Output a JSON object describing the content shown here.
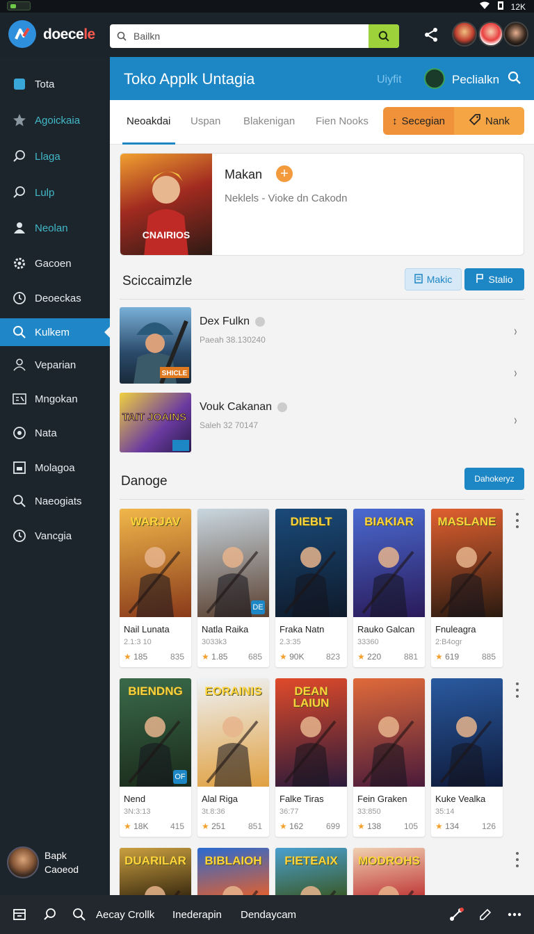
{
  "status": {
    "time": "12K"
  },
  "brand": {
    "name_main": "doece",
    "name_accent": "le"
  },
  "search": {
    "placeholder": "Bailkn"
  },
  "sidebar": {
    "items": [
      {
        "label": "Tota",
        "icon": "app-icon"
      },
      {
        "label": "Agoickaia",
        "icon": "star-icon"
      },
      {
        "label": "Llaga",
        "icon": "search-icon"
      },
      {
        "label": "Lulp",
        "icon": "search-icon"
      },
      {
        "label": "Neolan",
        "icon": "user-icon"
      },
      {
        "label": "Gacoen",
        "icon": "gear-icon"
      },
      {
        "label": "Deoeckas",
        "icon": "clock-icon"
      },
      {
        "label": "Kulkem",
        "icon": "search-icon"
      },
      {
        "label": "Veparian",
        "icon": "user-icon"
      },
      {
        "label": "Mngokan",
        "icon": "grid-icon"
      },
      {
        "label": "Nata",
        "icon": "circle-icon"
      },
      {
        "label": "Molagoa",
        "icon": "box-icon"
      },
      {
        "label": "Naeogiats",
        "icon": "search-icon"
      },
      {
        "label": "Vancgia",
        "icon": "clock-icon"
      }
    ],
    "user": {
      "line1": "Bapk",
      "line2": "Caoeod"
    }
  },
  "header": {
    "title": "Toko Applk Untagia",
    "link": "Uiyfit",
    "label": "Peclialkn"
  },
  "tabs": [
    {
      "label": "Neoakdai"
    },
    {
      "label": "Uspan"
    },
    {
      "label": "Blakenigan"
    },
    {
      "label": "Fien Nooks"
    }
  ],
  "actions": {
    "primary": "Secegian",
    "secondary": "Nank"
  },
  "featured": {
    "title": "Makan",
    "subtitle": "Neklels - Vioke dn Cakodn",
    "art_text": "CNAIRIOS"
  },
  "section1": {
    "title": "Sciccaimzle",
    "btn_light": "Makic",
    "btn_dark": "Stalio"
  },
  "list": [
    {
      "title": "Dex Fulkn",
      "sub": "Paeah 38.130240",
      "badge": "SHICLE"
    },
    {
      "title": "Vouk Cakanan",
      "sub": "Saleh 32 70147",
      "art": "TAIT JOAINS"
    }
  ],
  "section2": {
    "title": "Danoge",
    "btn": "Dahokeryz"
  },
  "cards": [
    {
      "name": "Nail Lunata",
      "sub": "2.1:3 10",
      "rating": "185",
      "count": "835",
      "art": "WARJAV",
      "bg": [
        "#f0b74a",
        "#8a3a1a"
      ]
    },
    {
      "name": "Natla Raika",
      "sub": "3033k3",
      "rating": "1.85",
      "count": "685",
      "art": "",
      "badge": "DE",
      "bg": [
        "#c9d7e0",
        "#5a4030"
      ]
    },
    {
      "name": "Fraka Natn",
      "sub": "2.3:35",
      "rating": "90K",
      "count": "823",
      "art": "DIEBLT",
      "bg": [
        "#1a4a7a",
        "#0e1a2a"
      ]
    },
    {
      "name": "Rauko Galcan",
      "sub": "33360",
      "rating": "220",
      "count": "881",
      "art": "BIAKIAR",
      "bg": [
        "#4a6ad0",
        "#2a1a5a"
      ]
    },
    {
      "name": "Fnuleagra",
      "sub": "2:B4ogr",
      "rating": "619",
      "count": "885",
      "art": "MASLANE",
      "bg": [
        "#e06030",
        "#2a1a10"
      ]
    },
    {
      "name": "Nend",
      "sub": "3N:3:13",
      "rating": "18K",
      "count": "415",
      "art": "BIENDNG",
      "badge": "OF",
      "bg": [
        "#3a6a4a",
        "#1a2a1a"
      ]
    },
    {
      "name": "Alal Riga",
      "sub": "3t.8:36",
      "rating": "251",
      "count": "851",
      "art": "EORAINIS",
      "bg": [
        "#eef2f6",
        "#e0a040"
      ]
    },
    {
      "name": "Falke Tiras",
      "sub": "36:77",
      "rating": "162",
      "count": "699",
      "art": "DEAN LAIUN",
      "bg": [
        "#e04a2a",
        "#2a1a3a"
      ]
    },
    {
      "name": "Fein Graken",
      "sub": "33:850",
      "rating": "138",
      "count": "105",
      "art": "",
      "bg": [
        "#e06a3a",
        "#4a1a3a"
      ]
    },
    {
      "name": "Kuke Vealka",
      "sub": "35:14",
      "rating": "134",
      "count": "126",
      "art": "",
      "bg": [
        "#2a5aa0",
        "#0e1a3a"
      ]
    },
    {
      "name": "",
      "sub": "",
      "rating": "",
      "count": "",
      "art": "DUARILAR",
      "bg": [
        "#caa040",
        "#3a2a10"
      ]
    },
    {
      "name": "",
      "sub": "",
      "rating": "",
      "count": "",
      "art": "BIBLAIOH",
      "bg": [
        "#2a6ad0",
        "#e06030"
      ]
    },
    {
      "name": "",
      "sub": "",
      "rating": "",
      "count": "",
      "art": "FIETEAIX",
      "bg": [
        "#4aa0d0",
        "#3a5a2a"
      ]
    },
    {
      "name": "",
      "sub": "",
      "rating": "",
      "count": "",
      "art": "MODROHS",
      "bg": [
        "#f0d0b0",
        "#c03a3a"
      ]
    }
  ],
  "bottombar": {
    "item1": "Aecay Crollk",
    "item2": "Inederapin",
    "item3": "Dendaycam"
  }
}
